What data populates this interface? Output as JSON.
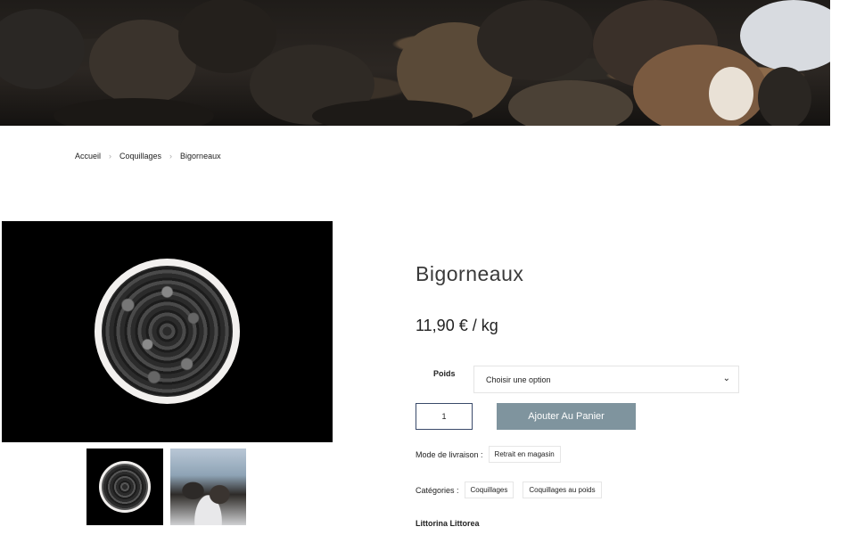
{
  "breadcrumb": {
    "home": "Accueil",
    "category": "Coquillages",
    "current": "Bigorneaux",
    "separator_icon": "chevron-right-icon"
  },
  "product": {
    "title": "Bigorneaux",
    "price": "11,90 € / kg",
    "option_label": "Poids",
    "option_placeholder": "Choisir une option",
    "quantity": "1",
    "add_to_cart": "Ajouter Au Panier",
    "delivery_label": "Mode de livraison :",
    "delivery_value": "Retrait en magasin",
    "categories_label": "Catégories :",
    "categories": [
      "Coquillages",
      "Coquillages au poids"
    ],
    "latin_name": "Littorina Littorea"
  },
  "colors": {
    "button_bg": "#7f949e",
    "qty_border": "#3a4a6a"
  }
}
